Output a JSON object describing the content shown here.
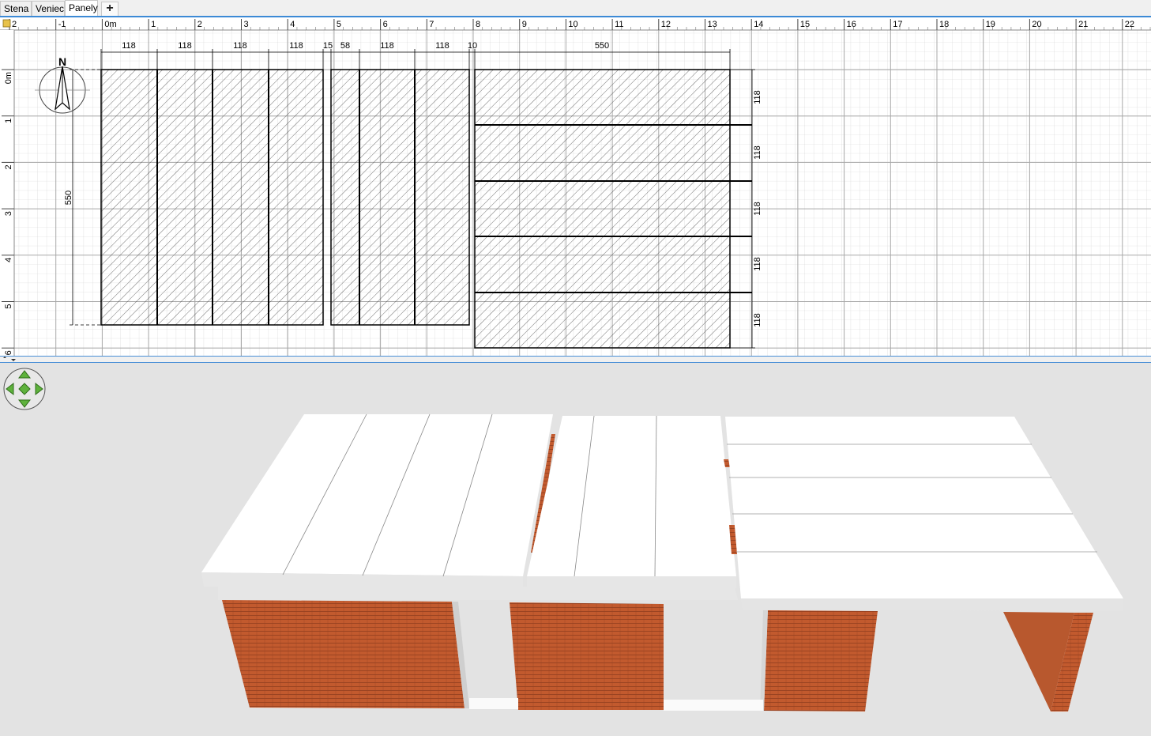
{
  "tabs": [
    {
      "label": "Stena",
      "active": false
    },
    {
      "label": "Veniec",
      "active": false
    },
    {
      "label": "Panely",
      "active": true
    }
  ],
  "add_tab_symbol": "+",
  "colors": {
    "accent": "#3c8ad6",
    "brick": "#c0502a",
    "panel": "#ffffff",
    "grid": "#d0d0d0"
  },
  "plan": {
    "ruler_x_labels": [
      "2",
      "-1",
      "0m",
      "1",
      "2",
      "3",
      "4",
      "5",
      "6",
      "7",
      "8",
      "9",
      "10",
      "11",
      "12",
      "13",
      "14",
      "15",
      "16",
      "17",
      "18",
      "19",
      "20",
      "21",
      "22"
    ],
    "ruler_y_labels": [
      "0m",
      "1",
      "2",
      "3",
      "4",
      "5",
      "6"
    ],
    "compass_label": "N",
    "top_dimensions": [
      "118",
      "118",
      "118",
      "118",
      "15",
      "58",
      "118",
      "118",
      "10",
      "550"
    ],
    "left_dimension": "550",
    "right_dimensions": [
      "118",
      "118",
      "118",
      "118",
      "118"
    ]
  },
  "view3d": {
    "navigator_icon": "navigation-arrows-icon"
  }
}
